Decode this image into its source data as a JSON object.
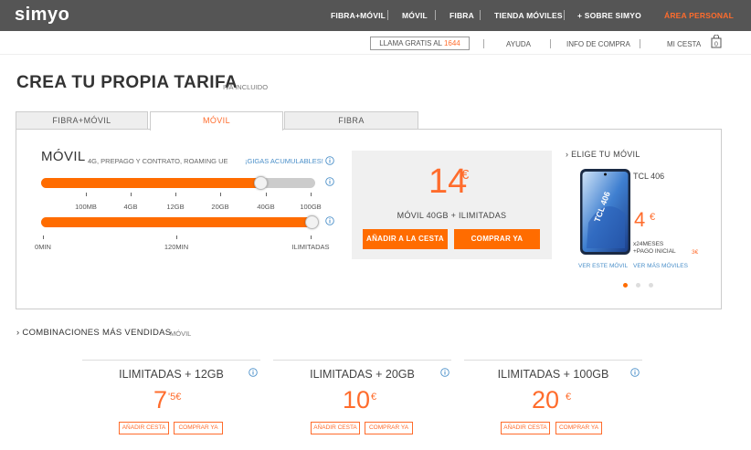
{
  "brand": {
    "logo": "simyo",
    "accent_color": "#ff6c2c",
    "link_color": "#4a8fc9",
    "topbar_color": "#555555"
  },
  "nav": {
    "items": [
      "FIBRA+MÓVIL",
      "MÓVIL",
      "FIBRA",
      "TIENDA MÓVILES",
      "+ SOBRE SIMYO"
    ],
    "area_personal": "ÁREA PERSONAL"
  },
  "subnav": {
    "call_label": "LLAMA GRATIS AL",
    "call_number": "1644",
    "ayuda": "AYUDA",
    "info_compra": "INFO DE COMPRA",
    "mi_cesta": "MI CESTA",
    "cart_count": "0"
  },
  "page": {
    "title": "CREA TU PROPIA TARIFA",
    "iva": "IVA INCLUIDO"
  },
  "tabs": [
    {
      "label": "FIBRA+MÓVIL",
      "active": false
    },
    {
      "label": "MÓVIL",
      "active": true
    },
    {
      "label": "FIBRA",
      "active": false
    }
  ],
  "config": {
    "title": "MÓVIL",
    "description": "4G, PREPAGO Y CONTRATO, ROAMING UE",
    "gigas_link": "¡GIGAS ACUMULABLES!",
    "data_slider": {
      "ticks": [
        "100MB",
        "4GB",
        "12GB",
        "20GB",
        "40GB",
        "100GB"
      ],
      "selected": "40GB",
      "fill_fraction": 0.8
    },
    "minutes_slider": {
      "ticks": [
        "0MIN",
        "120MIN",
        "ILIMITADAS"
      ],
      "selected": "ILIMITADAS",
      "fill_fraction": 1.0
    }
  },
  "price": {
    "amount": "14",
    "currency": "€",
    "plan": "MÓVIL 40GB + ILIMITADAS",
    "add_to_cart": "AÑADIR A LA CESTA",
    "buy_now": "COMPRAR YA"
  },
  "phone": {
    "heading": "ELIGE TU MÓVIL",
    "name": "TCL 406",
    "brand_mark": "TCL 406",
    "price": "4",
    "currency": "€",
    "terms_line1": "x24MESES",
    "terms_line2": "+PAGO INICIAL",
    "initial_payment": "3€",
    "see_phone": "VER ESTE MÓVIL",
    "see_more": "VER MÁS MÓVILES",
    "carousel_total": 3,
    "carousel_active": 1
  },
  "combos": {
    "heading": "COMBINACIONES MÁS VENDIDAS",
    "subheading": "MÓVIL",
    "items": [
      {
        "title": "ILIMITADAS + 12GB",
        "price": "7",
        "decimals": "'5€",
        "add": "AÑADIR CESTA",
        "buy": "COMPRAR YA"
      },
      {
        "title": "ILIMITADAS + 20GB",
        "price": "10",
        "decimals": "€",
        "add": "AÑADIR CESTA",
        "buy": "COMPRAR YA"
      },
      {
        "title": "ILIMITADAS + 100GB",
        "price": "20",
        "decimals": "€",
        "add": "AÑADIR CESTA",
        "buy": "COMPRAR YA"
      }
    ]
  }
}
